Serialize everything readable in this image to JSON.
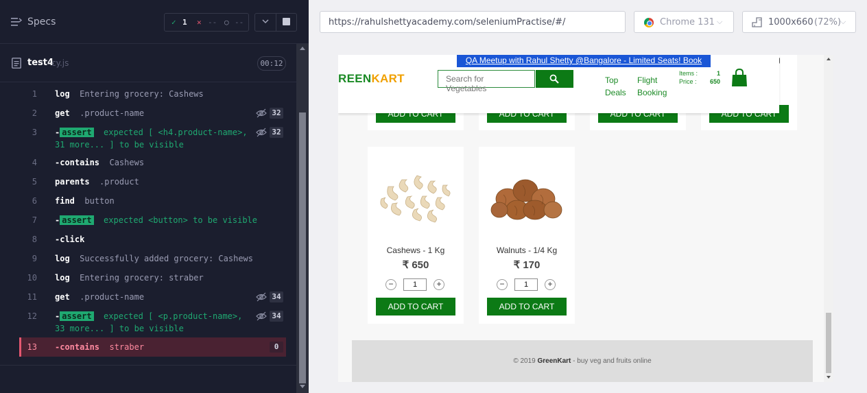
{
  "runner": {
    "specs_label": "Specs",
    "stats": {
      "passed": "1",
      "failed": "--",
      "pending": "--"
    },
    "file": {
      "name": "test4",
      "ext": "cy.js",
      "duration": "00:12"
    },
    "commands": [
      {
        "num": "1",
        "name": "log",
        "arg": "Entering grocery: Cashews"
      },
      {
        "num": "2",
        "name": "get",
        "arg": ".product-name",
        "count": "32"
      },
      {
        "num": "3",
        "name": "-assert",
        "line1": "expected [ <h4.product-name>,",
        "line2": "31 more... ] to be visible",
        "count": "32"
      },
      {
        "num": "4",
        "name": "-contains",
        "arg": "Cashews"
      },
      {
        "num": "5",
        "name": "parents",
        "arg": ".product"
      },
      {
        "num": "6",
        "name": "find",
        "arg": "button"
      },
      {
        "num": "7",
        "name": "-assert",
        "line1": "expected <button> to be visible"
      },
      {
        "num": "8",
        "name": "-click"
      },
      {
        "num": "9",
        "name": "log",
        "arg": "Successfully added grocery: Cashews"
      },
      {
        "num": "10",
        "name": "log",
        "arg": "Entering grocery: straber"
      },
      {
        "num": "11",
        "name": "get",
        "arg": ".product-name",
        "count": "34"
      },
      {
        "num": "12",
        "name": "-assert",
        "line1": "expected [ <p.product-name>,",
        "line2": "33 more... ] to be visible",
        "count": "34"
      },
      {
        "num": "13",
        "name": "-contains",
        "arg": "straber",
        "count": "0"
      }
    ],
    "assert_label": "assert"
  },
  "browser": {
    "url": "https://rahulshettyacademy.com/seleniumPractise/#/",
    "name": "Chrome 131",
    "viewport": "1000x660",
    "scale": "(72%)"
  },
  "app": {
    "banner": "QA Meetup with Rahul Shetty @Bangalore - Limited Seats! Book Now!",
    "logo_green": "REEN",
    "logo_kart": "KART",
    "search_placeholder": "Search for Vegetables",
    "nav": {
      "top": "Top",
      "deals": "Deals",
      "flight": "Flight",
      "booking": "Booking"
    },
    "cart": {
      "items_label": "Items  :",
      "items_value": "1",
      "price_label": "Price  :",
      "price_value": "650"
    },
    "right_edge_char": "g",
    "top_row_button": "ADD TO CART",
    "products": [
      {
        "name": "Cashews - 1 Kg",
        "price": "₹ 650",
        "qty": "1",
        "button": "ADD TO CART"
      },
      {
        "name": "Walnuts - 1/4 Kg",
        "price": "₹ 170",
        "qty": "1",
        "button": "ADD TO CART"
      }
    ],
    "qty_minus": "−",
    "qty_plus": "+",
    "footer": {
      "prefix": "© 2019 ",
      "brand": "GreenKart",
      "suffix": " - buy veg and fruits online"
    }
  },
  "colors": {
    "pass": "#1fa971",
    "fail": "#e45770",
    "green": "#0c7a15",
    "accent_orange": "#f0a000",
    "banner_blue": "#1a56d6"
  }
}
